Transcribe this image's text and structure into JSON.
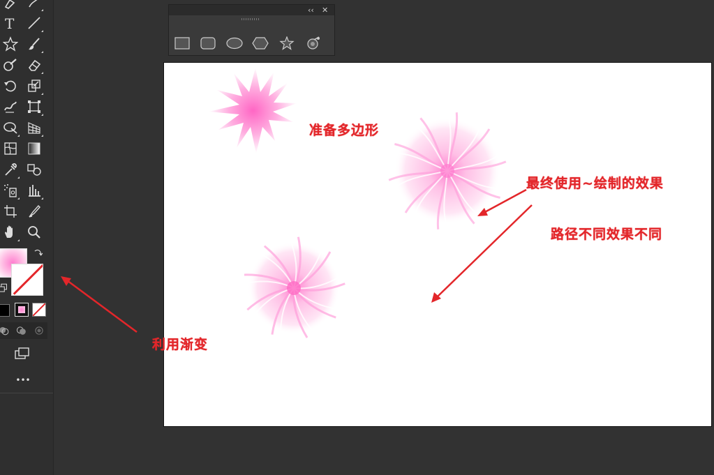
{
  "toolbar": {
    "tools": [
      {
        "name": "pen-tool-icon",
        "label": "Pen"
      },
      {
        "name": "line-tool-icon",
        "label": "Line"
      },
      {
        "name": "type-tool-icon",
        "label": "T"
      },
      {
        "name": "star-tool-icon",
        "label": "Star"
      },
      {
        "name": "paintbrush-tool-icon",
        "label": "Paintbrush"
      },
      {
        "name": "shaper-tool-icon",
        "label": "Shaper"
      },
      {
        "name": "eraser-tool-icon",
        "label": "Eraser"
      },
      {
        "name": "rotate-tool-icon",
        "label": "Rotate"
      },
      {
        "name": "scale-tool-icon",
        "label": "Scale"
      },
      {
        "name": "warp-tool-icon",
        "label": "Warp"
      },
      {
        "name": "free-transform-tool-icon",
        "label": "Free Transform"
      },
      {
        "name": "shape-builder-tool-icon",
        "label": "Shape Builder"
      },
      {
        "name": "perspective-grid-tool-icon",
        "label": "Perspective Grid"
      },
      {
        "name": "mesh-tool-icon",
        "label": "Mesh"
      },
      {
        "name": "gradient-tool-icon",
        "label": "Gradient"
      },
      {
        "name": "eyedropper-tool-icon",
        "label": "Eyedropper"
      },
      {
        "name": "blend-tool-icon",
        "label": "Blend"
      },
      {
        "name": "symbol-sprayer-tool-icon",
        "label": "Symbol Sprayer"
      },
      {
        "name": "column-graph-tool-icon",
        "label": "Column Graph"
      },
      {
        "name": "artboard-tool-icon",
        "label": "Artboard"
      },
      {
        "name": "slice-tool-icon",
        "label": "Slice"
      },
      {
        "name": "hand-tool-icon",
        "label": "Hand"
      },
      {
        "name": "zoom-tool-icon",
        "label": "Zoom"
      }
    ],
    "more_label": "•••"
  },
  "shape_panel": {
    "collapse_label": "‹‹",
    "close_label": "✕",
    "shapes": [
      "rectangle",
      "rounded-rectangle",
      "ellipse",
      "polygon",
      "star",
      "flare"
    ]
  },
  "annotations": {
    "prepare_polygon": "准备多边形",
    "final_effect": "最终使用~绘制的效果",
    "different_paths": "路径不同效果不同",
    "use_gradient": "利用渐变"
  },
  "colors": {
    "annotation": "#e3262a",
    "gradient_center": "#ff7fcf",
    "gradient_edge": "#ffffff"
  }
}
